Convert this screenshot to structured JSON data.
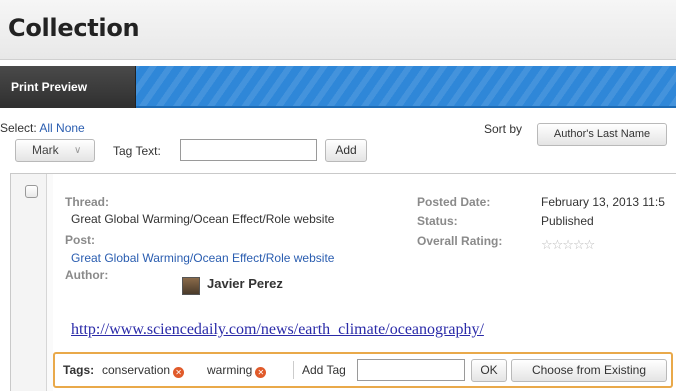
{
  "page": {
    "title": "Collection"
  },
  "toolbar": {
    "print_preview": "Print Preview"
  },
  "select_row": {
    "label": "Select:",
    "all": "All",
    "none": "None"
  },
  "sort": {
    "label": "Sort by",
    "button": "Author's Last Name"
  },
  "actions": {
    "mark": "Mark",
    "tag_text_label": "Tag Text:",
    "tag_text_value": "",
    "add": "Add"
  },
  "post": {
    "thread_label": "Thread:",
    "thread_value": "Great Global Warming/Ocean Effect/Role website",
    "post_label": "Post:",
    "post_value": "Great Global Warming/Ocean Effect/Role website",
    "author_label": "Author:",
    "author_name": "Javier Perez",
    "posted_date_label": "Posted Date:",
    "posted_date_value": "February 13, 2013 11:5",
    "status_label": "Status:",
    "status_value": "Published",
    "rating_label": "Overall Rating:",
    "rating_stars": "☆☆☆☆☆",
    "url": "http://www.sciencedaily.com/news/earth_climate/oceanography/"
  },
  "tags": {
    "label": "Tags:",
    "items": [
      {
        "name": "conservation"
      },
      {
        "name": "warming"
      }
    ],
    "remove_glyph": "✕",
    "add_tag_label": "Add Tag",
    "add_tag_value": "",
    "ok": "OK",
    "choose": "Choose from Existing"
  },
  "colors": {
    "accent_blue": "#2f87d8",
    "highlight_orange": "#e9a94a",
    "link": "#2a5db0"
  }
}
